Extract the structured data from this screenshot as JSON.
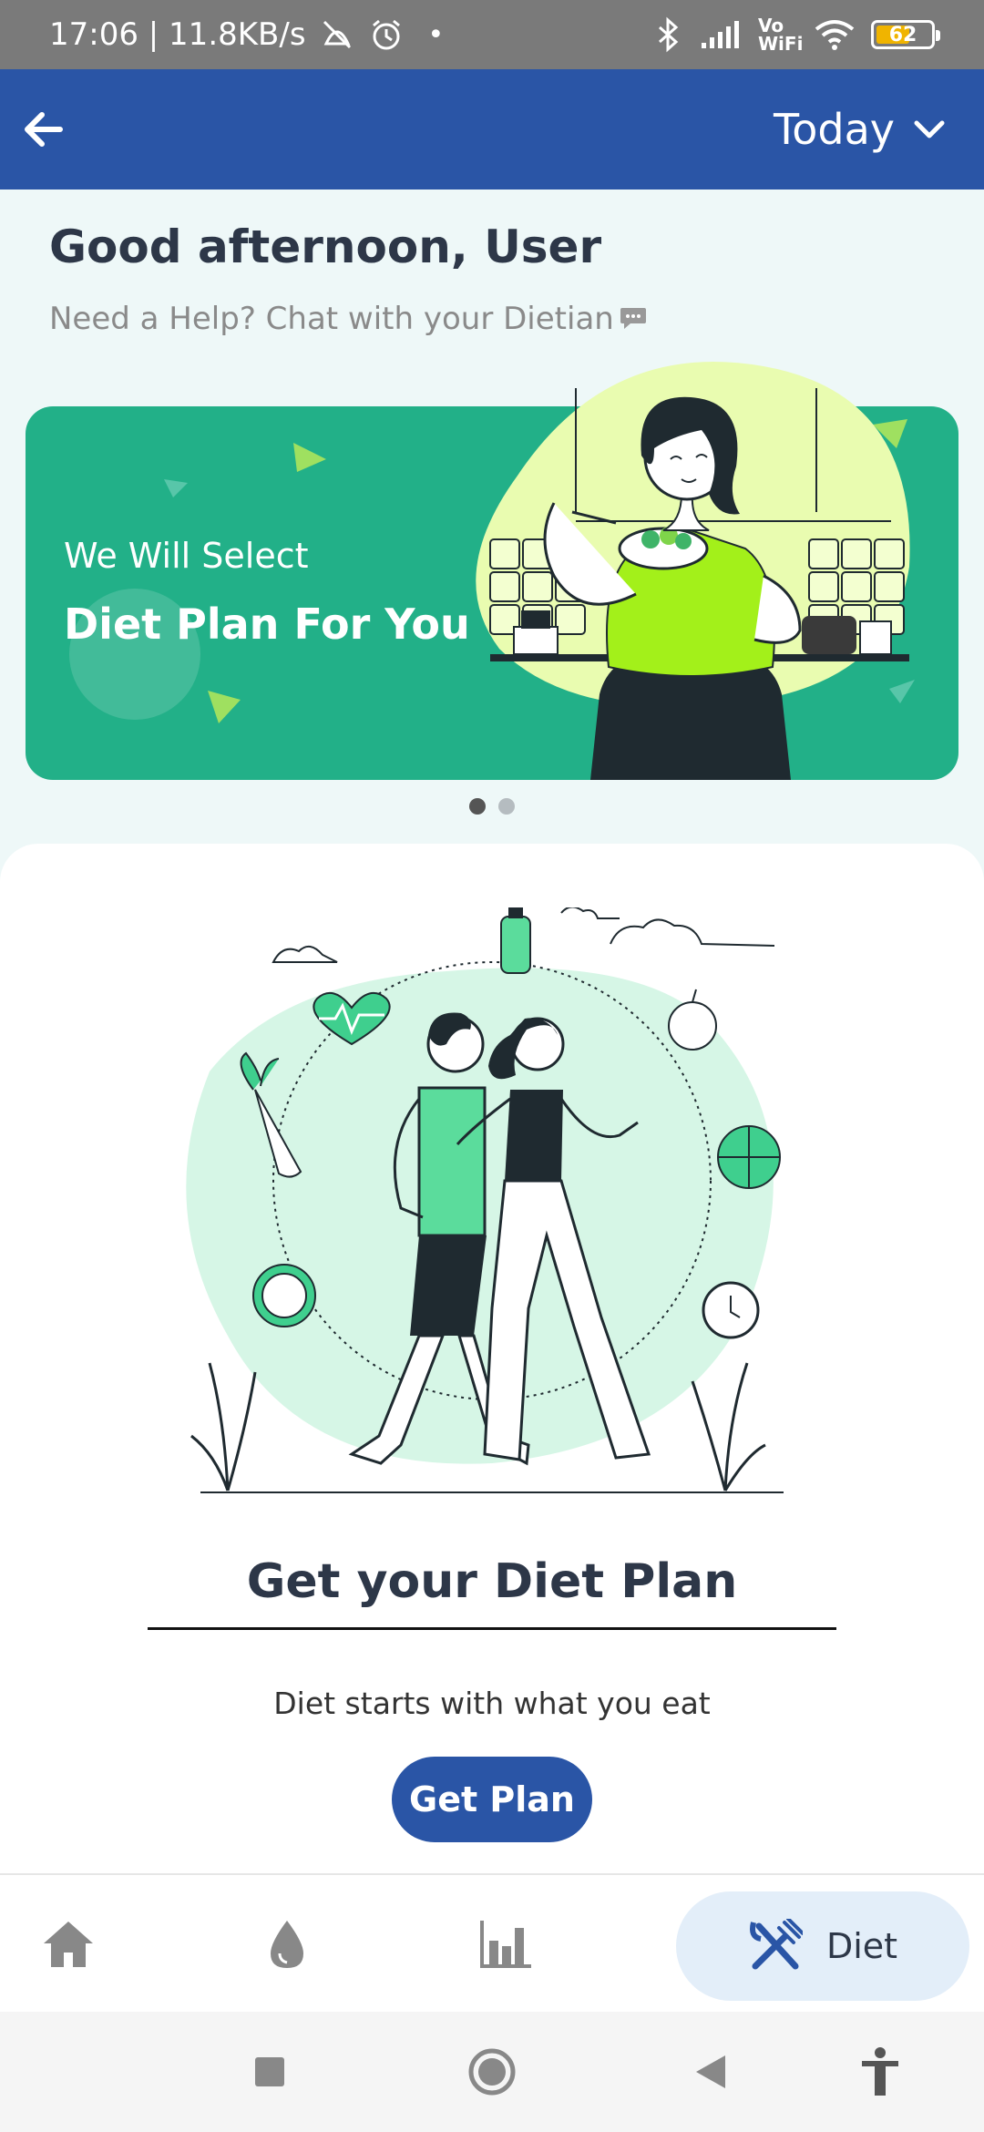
{
  "status_bar": {
    "time_speed": "17:06 | 11.8KB/s",
    "network_label": "Vo WiFi",
    "battery_level": "62"
  },
  "app_bar": {
    "date_label": "Today"
  },
  "greeting": {
    "title": "Good afternoon, User",
    "help_text": "Need a Help? Chat with your Dietian"
  },
  "banner": {
    "line1": "We Will Select",
    "line2": "Diet Plan For You",
    "page_count": 2,
    "active_page": 1
  },
  "plan_card": {
    "title": "Get your Diet Plan",
    "subtitle": "Diet starts with what you eat",
    "button_label": "Get Plan"
  },
  "bottom_nav": {
    "items": [
      {
        "icon": "home-icon"
      },
      {
        "icon": "water-drop-icon"
      },
      {
        "icon": "bar-chart-icon"
      },
      {
        "icon": "fork-knife-icon",
        "label": "Diet",
        "active": true
      }
    ]
  },
  "colors": {
    "primary": "#2a55a6",
    "banner": "#22b088",
    "background": "#eef8f8",
    "accent_green": "#a3f01a"
  }
}
